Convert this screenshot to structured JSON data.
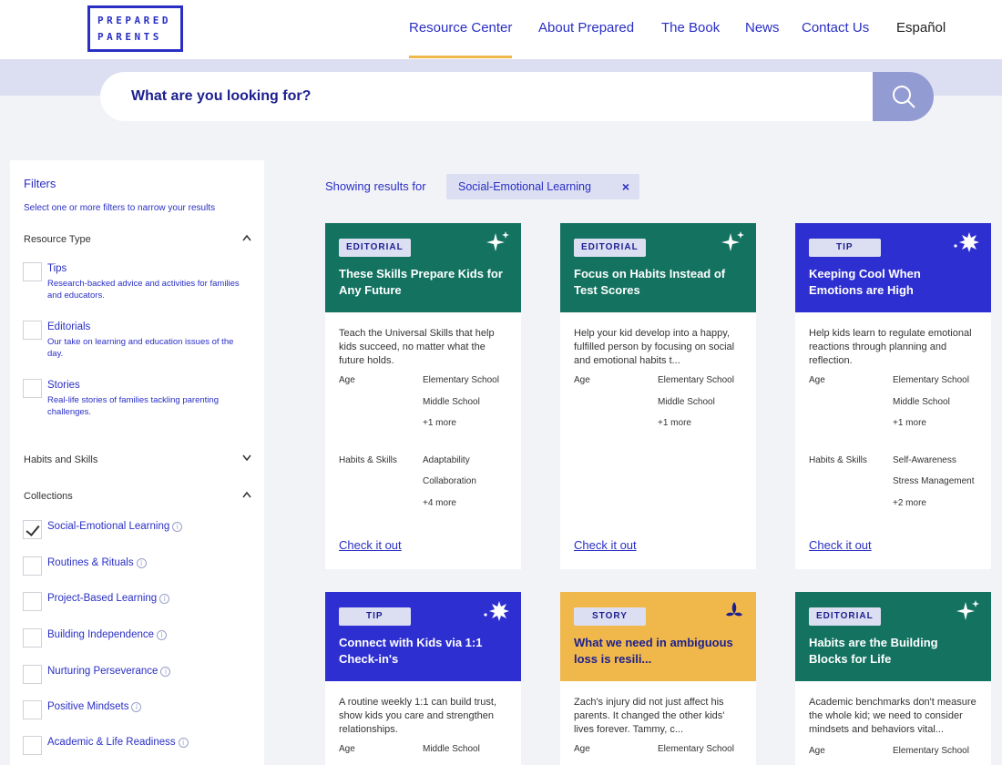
{
  "colors": {
    "brand": "#2a2fc4",
    "accent": "#f0b84b",
    "editorial": "#137260",
    "tip": "#2e2fd0",
    "story": "#f0b84b"
  },
  "logo": {
    "line1": "PREPARED",
    "line2": "PARENTS"
  },
  "nav": [
    "Resource Center",
    "About Prepared",
    "The Book",
    "News",
    "Contact Us",
    "Español"
  ],
  "search": {
    "placeholder": "What are you looking for?",
    "icon": "search-icon"
  },
  "filters": {
    "title": "Filters",
    "subtitle": "Select one or more filters to narrow your results",
    "resource_type": {
      "label": "Resource Type",
      "options": [
        {
          "label": "Tips",
          "desc": "Research-backed advice and activities for families and educators."
        },
        {
          "label": "Editorials",
          "desc": "Our take on learning and education issues of the day."
        },
        {
          "label": "Stories",
          "desc": "Real-life stories of families tackling parenting challenges."
        }
      ]
    },
    "habits": {
      "label": "Habits and Skills"
    },
    "collections": {
      "label": "Collections",
      "items": [
        {
          "label": "Social-Emotional Learning",
          "checked": true
        },
        {
          "label": "Routines & Rituals",
          "checked": false
        },
        {
          "label": "Project-Based Learning",
          "checked": false
        },
        {
          "label": "Building Independence",
          "checked": false
        },
        {
          "label": "Nurturing Perseverance",
          "checked": false
        },
        {
          "label": "Positive Mindsets",
          "checked": false
        },
        {
          "label": "Academic & Life Readiness",
          "checked": false
        }
      ]
    }
  },
  "results": {
    "showing": "Showing results for",
    "chip": "Social-Emotional Learning",
    "close": "×",
    "cards": [
      {
        "tag": "EDITORIAL",
        "title": "These Skills Prepare Kids for Any Future",
        "desc": "Teach the Universal Skills that help kids succeed, no matter what the future holds.",
        "age_label": "Age",
        "ages": [
          "Elementary School",
          "Middle School",
          "+1 more"
        ],
        "skills_label": "Habits & Skills",
        "skills": [
          "Adaptability",
          "Collaboration",
          "+4 more"
        ],
        "link": "Check it out"
      },
      {
        "tag": "EDITORIAL",
        "title": "Focus on Habits Instead of Test Scores",
        "desc": "Help your kid develop into a happy, fulfilled person by focusing on social and emotional habits t...",
        "age_label": "Age",
        "ages": [
          "Elementary School",
          "Middle School",
          "+1 more"
        ],
        "link": "Check it out"
      },
      {
        "tag": "TIP",
        "title": "Keeping Cool When Emotions are High",
        "desc": "Help kids learn to regulate emotional reactions through planning and reflection.",
        "age_label": "Age",
        "ages": [
          "Elementary School",
          "Middle School",
          "+1 more"
        ],
        "skills_label": "Habits & Skills",
        "skills": [
          "Self-Awareness",
          "Stress Management",
          "+2 more"
        ],
        "link": "Check it out"
      },
      {
        "tag": "TIP",
        "title": "Connect with Kids via 1:1 Check-in's",
        "desc": "A routine weekly 1:1 can build trust, show kids you care and strengthen relationships.",
        "age_label": "Age",
        "ages": [
          "Middle School"
        ]
      },
      {
        "tag": "STORY",
        "title": "What we need in ambiguous loss is resili...",
        "desc": "Zach's injury did not just affect his parents. It changed the other kids' lives forever. Tammy, c...",
        "age_label": "Age",
        "ages": [
          "Elementary School"
        ]
      },
      {
        "tag": "EDITORIAL",
        "title": "Habits are the Building Blocks for Life",
        "desc": "Academic benchmarks don't measure the whole kid; we need to consider mindsets and behaviors vital...",
        "age_label": "Age",
        "ages": [
          "Elementary School"
        ]
      }
    ]
  }
}
